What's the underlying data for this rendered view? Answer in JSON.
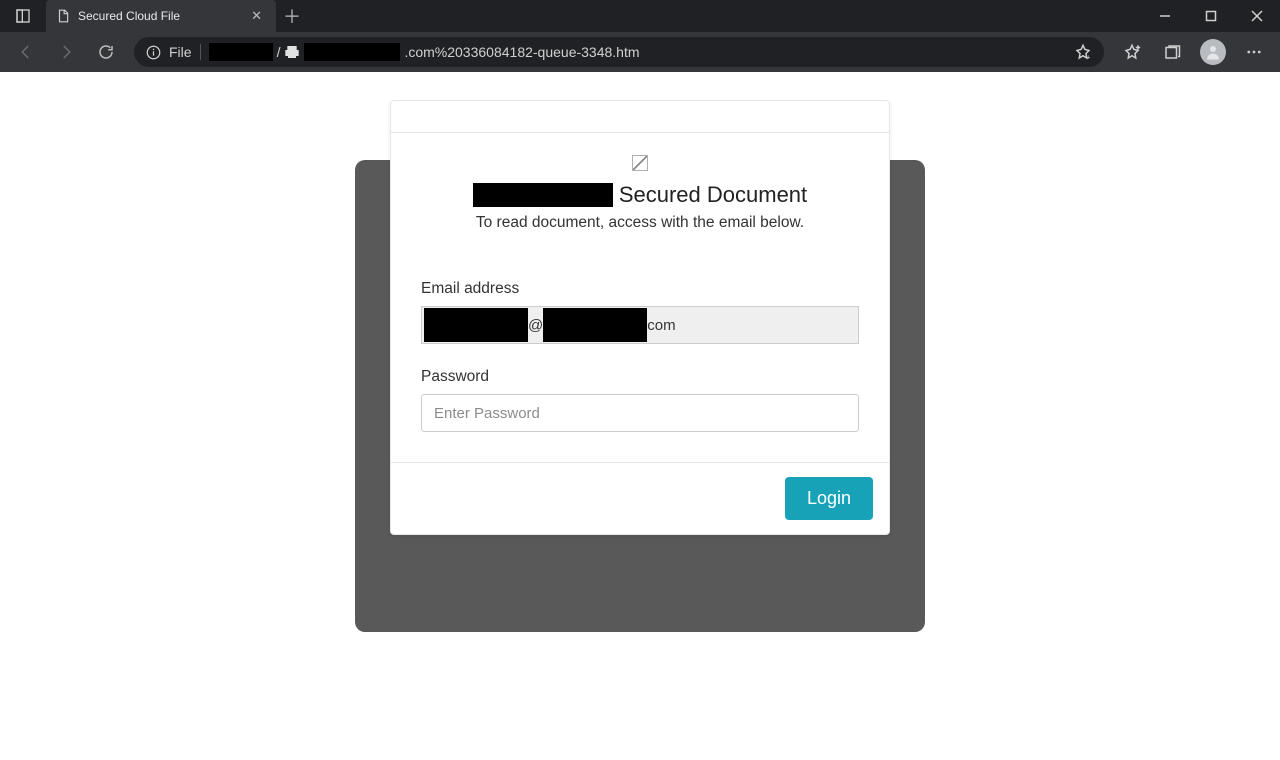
{
  "browser": {
    "tab_title": "Secured Cloud File",
    "url_prefix": "File",
    "url_visible_suffix": ".com%20336084182-queue-3348.htm"
  },
  "modal": {
    "title_suffix": "Secured Document",
    "subtitle": "To read document, access with the email below.",
    "email_label": "Email address",
    "email_at": "@",
    "email_tld": "com",
    "password_label": "Password",
    "password_placeholder": "Enter Password",
    "login_label": "Login"
  }
}
